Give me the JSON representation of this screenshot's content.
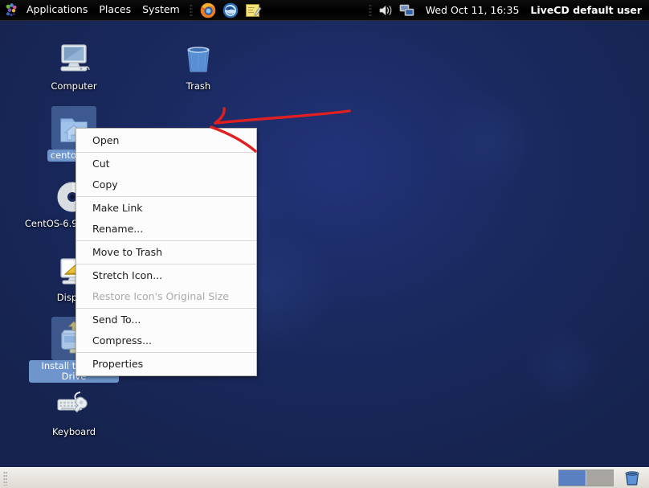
{
  "top_panel": {
    "logo_icon": "gnome-footprint-icon",
    "menus": [
      {
        "label": "Applications",
        "name": "applications-menu"
      },
      {
        "label": "Places",
        "name": "places-menu"
      },
      {
        "label": "System",
        "name": "system-menu"
      }
    ],
    "launchers": [
      {
        "name": "firefox-launcher-icon",
        "title": "Firefox Web Browser"
      },
      {
        "name": "thunderbird-launcher-icon",
        "title": "Thunderbird Mail"
      },
      {
        "name": "text-editor-launcher-icon",
        "title": "Text Editor"
      }
    ],
    "tray": [
      {
        "name": "volume-icon"
      },
      {
        "name": "network-icon"
      }
    ],
    "clock": "Wed Oct 11, 16:35",
    "user": "LiveCD default user"
  },
  "desktop": {
    "icons": [
      {
        "name": "desktop-icon-computer",
        "label": "Computer",
        "glyph": "computer-icon",
        "selected": false
      },
      {
        "name": "desktop-icon-trash",
        "label": "Trash",
        "glyph": "trash-icon",
        "selected": false
      },
      {
        "name": "desktop-icon-centoslive",
        "label": "centoslive",
        "glyph": "home-folder-icon",
        "selected": true
      },
      {
        "name": "desktop-icon-livecd",
        "label": "CentOS-6.9 LiveDVD",
        "glyph": "optical-disc-icon",
        "selected": false
      },
      {
        "name": "desktop-icon-display",
        "label": "Display",
        "glyph": "display-settings-icon",
        "selected": false
      },
      {
        "name": "desktop-icon-install",
        "label": "Install to Hard Drive",
        "glyph": "hard-drive-icon",
        "selected": true
      },
      {
        "name": "desktop-icon-keyboard",
        "label": "Keyboard",
        "glyph": "keyboard-settings-icon",
        "selected": false
      }
    ]
  },
  "context_menu": {
    "items": [
      {
        "label": "Open",
        "disabled": false,
        "separator_after": true
      },
      {
        "label": "Cut",
        "disabled": false,
        "separator_after": false
      },
      {
        "label": "Copy",
        "disabled": false,
        "separator_after": true
      },
      {
        "label": "Make Link",
        "disabled": false,
        "separator_after": false
      },
      {
        "label": "Rename...",
        "disabled": false,
        "separator_after": true
      },
      {
        "label": "Move to Trash",
        "disabled": false,
        "separator_after": true
      },
      {
        "label": "Stretch Icon...",
        "disabled": false,
        "separator_after": false
      },
      {
        "label": "Restore Icon's Original Size",
        "disabled": true,
        "separator_after": true
      },
      {
        "label": "Send To...",
        "disabled": false,
        "separator_after": false
      },
      {
        "label": "Compress...",
        "disabled": false,
        "separator_after": true
      },
      {
        "label": "Properties",
        "disabled": false,
        "separator_after": false
      }
    ]
  },
  "annotation": {
    "color": "#e02020",
    "description": "hand-drawn red arrow pointing at the Open menu item"
  },
  "bottom_panel": {
    "workspaces": [
      {
        "name": "workspace-1",
        "active": true
      },
      {
        "name": "workspace-2",
        "active": false
      }
    ],
    "trash_applet": "trash-applet-icon"
  },
  "colors": {
    "desktop_bg": "#1a2a5e",
    "panel_top_bg": "#000000",
    "panel_bottom_bg": "#e8e5e0",
    "menu_bg": "#fcfcfc",
    "selection": "#7eaae2",
    "annotation_red": "#e02020"
  }
}
